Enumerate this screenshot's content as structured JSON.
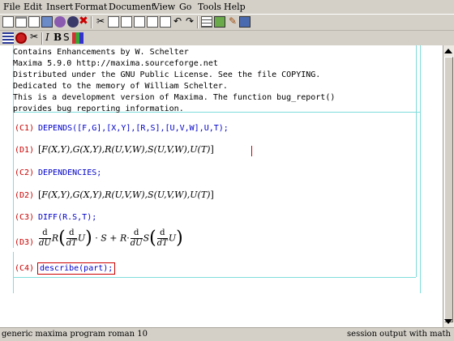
{
  "menu": [
    "File",
    "Edit",
    "Insert",
    "Format",
    "Document",
    "View",
    "Go",
    "Tools",
    "Help"
  ],
  "banner_lines": [
    "Contains Enhancements by W. Schelter",
    "Maxima 5.9.0 http://maxima.sourceforge.net",
    "Distributed under the GNU Public License. See the file COPYING.",
    "Dedicated to the memory of William Schelter.",
    "This is a development version of Maxima. The function bug_report()",
    "provides bug reporting information."
  ],
  "cells": {
    "c1": {
      "label": "(C1)",
      "input": "DEPENDS([F,G],[X,Y],[R,S],[U,V,W],U,T);"
    },
    "d1": {
      "label": "(D1)"
    },
    "c2": {
      "label": "(C2)",
      "input": "DEPENDENCIES;"
    },
    "d2": {
      "label": "(D2)"
    },
    "c3": {
      "label": "(C3)",
      "input": "DIFF(R.S,T);"
    },
    "d3": {
      "label": "(D3)"
    },
    "c4": {
      "label": "(C4)",
      "input": "describe(part);"
    }
  },
  "math": {
    "open_bracket": "[",
    "close_bracket": "]",
    "F_sym": "F",
    "G_sym": "G",
    "R_sym": "R",
    "S_sym": "S",
    "U_sym": "U",
    "XY_args": "(X,Y),",
    "UVW_args": "(U,V,W),",
    "UT_args": "(T)",
    "d": "d",
    "dU": "dU",
    "dT": "dT",
    "cdot": "·",
    "plus": "+",
    "lparen": "(",
    "rparen": ")"
  },
  "status": {
    "left": "generic maxima program roman 10",
    "right": "session output with math"
  },
  "colors": {
    "label": "#cc0000",
    "input": "#0000cc",
    "guide": "#7fdcdc"
  },
  "toolbar_icons": [
    "new-document-icon",
    "open-icon",
    "save-icon",
    "print-icon",
    "preview-icon",
    "web-icon",
    "cut-icon",
    "copy-icon",
    "paste-icon",
    "find-icon",
    "replace-icon",
    "spell-icon",
    "undo-icon",
    "redo-icon",
    "table-icon",
    "image-icon",
    "pen-icon",
    "symbol-icon"
  ],
  "format_icons": [
    "paragraph-icon",
    "stop-icon",
    "scissors-format-icon",
    "italic-icon",
    "bold-icon",
    "sans-icon",
    "color-icon"
  ],
  "format_labels": {
    "italic": "I",
    "bold": "B",
    "sans": "S"
  }
}
